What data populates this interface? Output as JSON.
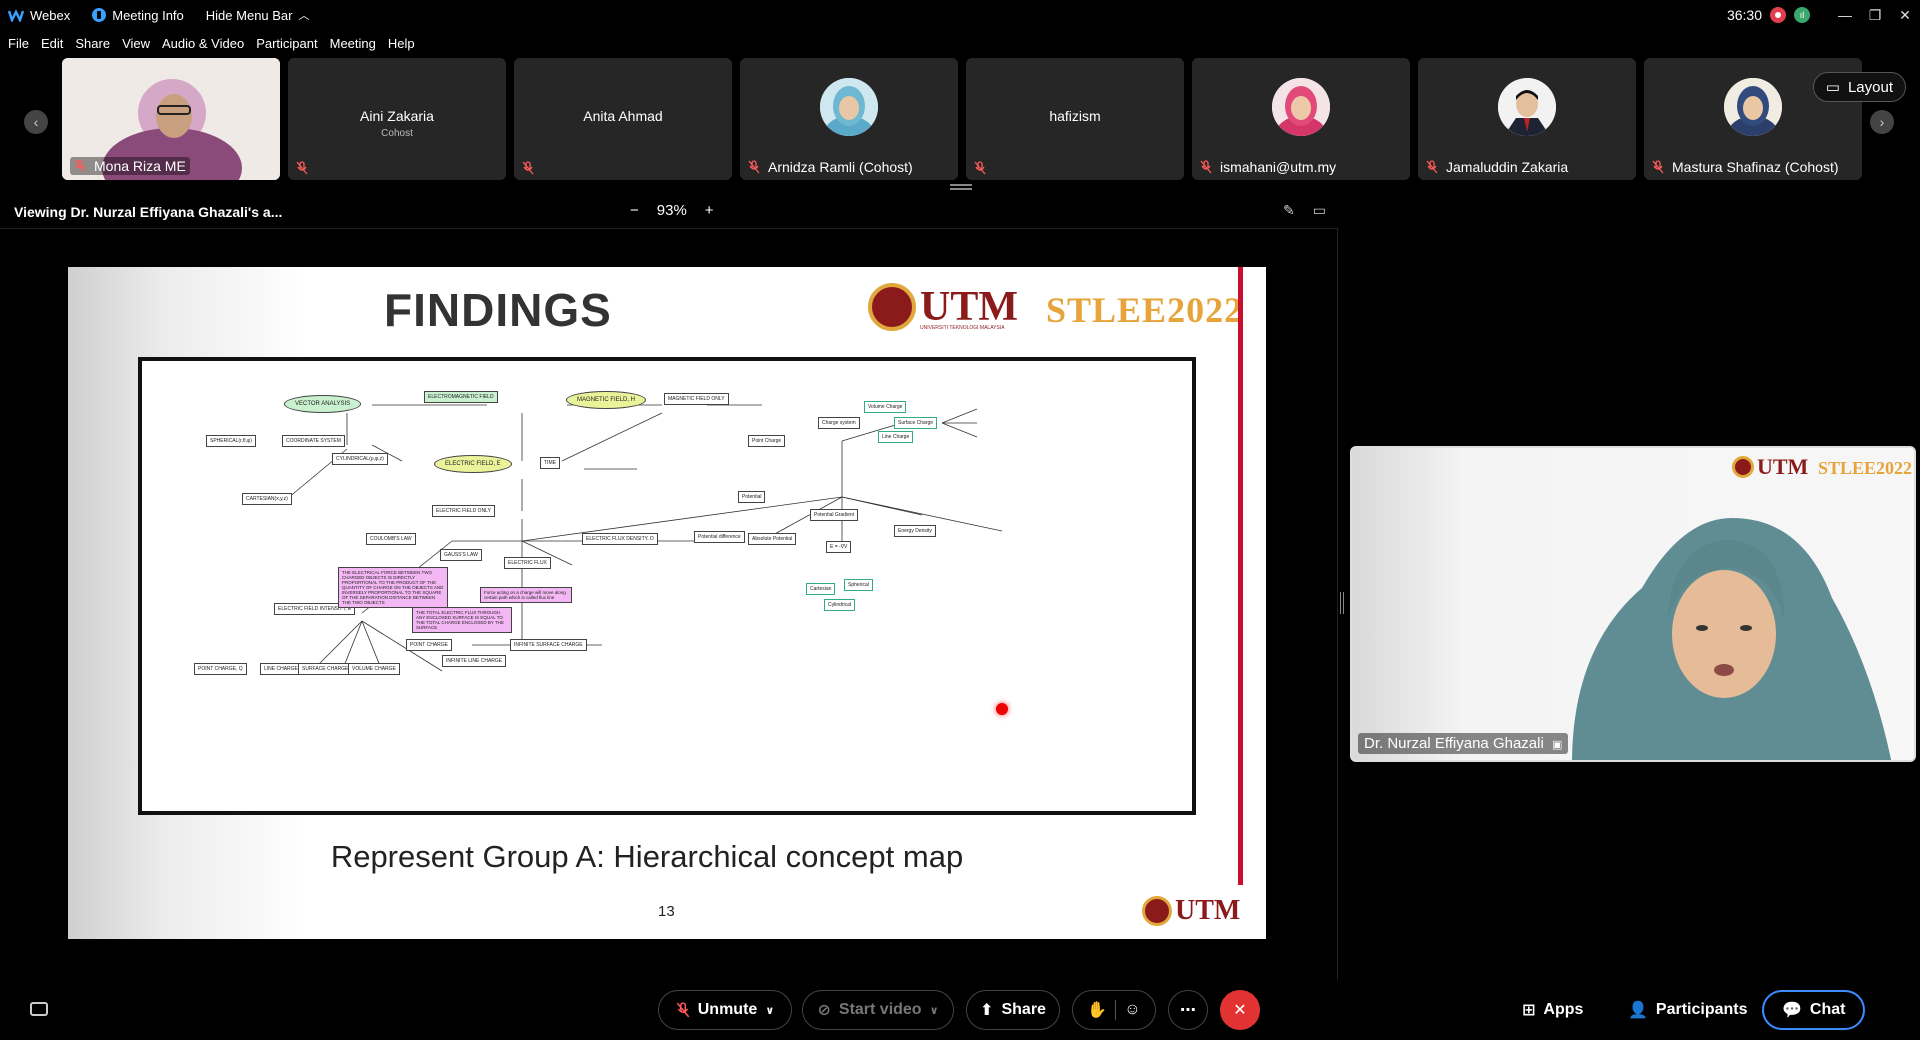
{
  "titlebar": {
    "app_name": "Webex",
    "meeting_info": "Meeting Info",
    "hide_menu": "Hide Menu Bar",
    "timer": "36:30"
  },
  "menu": [
    "File",
    "Edit",
    "Share",
    "View",
    "Audio & Video",
    "Participant",
    "Meeting",
    "Help"
  ],
  "participants": [
    {
      "name": "Mona Riza ME",
      "sub": "",
      "type": "video"
    },
    {
      "name": "",
      "center": "Aini Zakaria",
      "sub": "Cohost",
      "type": "name"
    },
    {
      "name": "",
      "center": "Anita Ahmad",
      "sub": "",
      "type": "name"
    },
    {
      "name": "Arnidza Ramli (Cohost)",
      "type": "avatar"
    },
    {
      "name": "",
      "center": "hafizism",
      "type": "name"
    },
    {
      "name": "ismahani@utm.my",
      "type": "avatar"
    },
    {
      "name": "Jamaluddin Zakaria",
      "type": "avatar"
    },
    {
      "name": "Mastura Shafinaz (Cohost)",
      "type": "avatar"
    }
  ],
  "layout_label": "Layout",
  "share": {
    "title": "Viewing Dr. Nurzal Effiyana Ghazali's a...",
    "zoom": "93%",
    "zoom_minus": "−",
    "zoom_plus": "+"
  },
  "slide": {
    "title": "FINDINGS",
    "utm": "UTM",
    "utm_sub": "UNIVERSITI TEKNOLOGI MALAYSIA",
    "stlee": "STLEE2022",
    "caption": "Represent Group A: Hierarchical concept map",
    "page": "13",
    "map": {
      "em_field": "ELECTROMAGNETIC FIELD",
      "vector_analysis": "VECTOR ANALYSIS",
      "magnetic_field": "MAGNETIC FIELD, H",
      "magnetic_only": "MAGNETIC FIELD ONLY",
      "electric_field": "ELECTRIC FIELD, E",
      "time": "TIME",
      "electric_only": "ELECTRIC FIELD ONLY",
      "coordinate": "COORDINATE SYSTEM",
      "spherical": "SPHERICAL(r,θ,φ)",
      "cylindrical": "CYLINDRICAL(ρ,φ,z)",
      "cartesian": "CARTESIAN(x,y,z)",
      "coulomb": "COULOMB'S LAW",
      "gauss": "GAUSS'S LAW",
      "flux_density": "ELECTRIC FLUX DENSITY, D",
      "electric_flux": "ELECTRIC FLUX",
      "field_intensity": "ELECTRIC FIELD INTENSITY, E",
      "coulomb_def": "THE ELECTRICAL FORCE BETWEEN TWO CHARGED OBJECTS IS DIRECTLY PROPORTIONAL TO THE PRODUCT OF THE QUANTITY OF CHARGE ON THE OBJECTS AND INVERSELY PROPORTIONAL TO THE SQUARE OF THE SEPARATION DISTANCE BETWEEN THE TWO OBJECTS",
      "gauss_def": "THE TOTAL ELECTRIC FLUX THROUGH ANY ENCLOSED SURFACE IS EQUAL TO THE TOTAL CHARGE ENCLOSED BY THE SURFACE",
      "flux_def": "Force acting on a charge will move along certain path which is called flux line",
      "point_charge": "POINT CHARGE, Q",
      "line_charge": "LINE CHARGE",
      "surface_charge": "SURFACE CHARGE",
      "volume_charge": "VOLUME CHARGE",
      "charge_system": "Charge system",
      "point_charge2": "Point Charge",
      "potential": "Potential",
      "potential_gradient": "Potential Gradient",
      "energy_density": "Energy Density",
      "potential_difference": "Potential difference",
      "absolute_potential": "Absolute Potential",
      "volume_charge2": "Volume Charge",
      "surface_charge2": "Surface Charge",
      "line_charge2": "Line Charge",
      "cartesian2": "Cartesian",
      "spherical2": "Spherical",
      "cylindrical2": "Cylindrical",
      "e_grad": "E = -∇V",
      "point_charge3": "POINT CHARGE",
      "infinite_line": "INFINITE LINE CHARGE",
      "infinite_surface": "INFINITE SURFACE CHARGE"
    }
  },
  "speaker": {
    "name": "Dr. Nurzal Effiyana Ghazali"
  },
  "controls": {
    "unmute": "Unmute",
    "start_video": "Start video",
    "share": "Share",
    "apps": "Apps",
    "participants": "Participants",
    "chat": "Chat"
  }
}
